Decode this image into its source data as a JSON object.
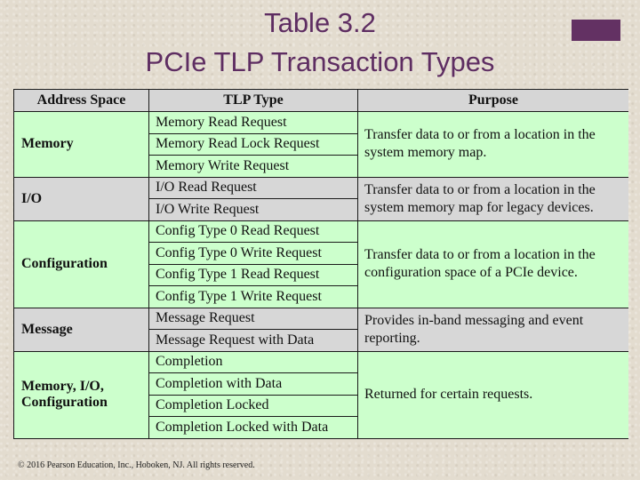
{
  "slide": {
    "title_line1": "Table 3.2",
    "title_line2": "PCIe TLP Transaction Types",
    "accent_color": "#633163",
    "title_color": "#5e2d62"
  },
  "table": {
    "headers": {
      "address_space": "Address Space",
      "tlp_type": "TLP Type",
      "purpose": "Purpose"
    },
    "groups": [
      {
        "address_space": "Memory",
        "tlp_types": [
          "Memory Read Request",
          "Memory Read Lock Request",
          "Memory Write Request"
        ],
        "purpose": "Transfer data to or from a location in the system memory map.",
        "color": "#ccffcc"
      },
      {
        "address_space": "I/O",
        "tlp_types": [
          "I/O Read Request",
          "I/O Write Request"
        ],
        "purpose": "Transfer data to or from a location in the system memory map for legacy devices.",
        "color": "#d7d7d7"
      },
      {
        "address_space": "Configuration",
        "tlp_types": [
          "Config Type 0 Read Request",
          "Config Type 0 Write Request",
          "Config Type 1 Read Request",
          "Config Type 1 Write Request"
        ],
        "purpose": "Transfer data to or from a location in the configuration space of a PCIe device.",
        "color": "#ccffcc"
      },
      {
        "address_space": "Message",
        "tlp_types": [
          "Message Request",
          "Message Request with Data"
        ],
        "purpose": "Provides in-band messaging and event reporting.",
        "color": "#d7d7d7"
      },
      {
        "address_space": "Memory, I/O, Configuration",
        "tlp_types": [
          "Completion",
          "Completion with Data",
          "Completion Locked",
          "Completion Locked with Data"
        ],
        "purpose": "Returned for certain requests.",
        "color": "#ccffcc"
      }
    ]
  },
  "footer": {
    "copyright": "© 2016 Pearson Education, Inc., Hoboken, NJ. All rights reserved."
  }
}
